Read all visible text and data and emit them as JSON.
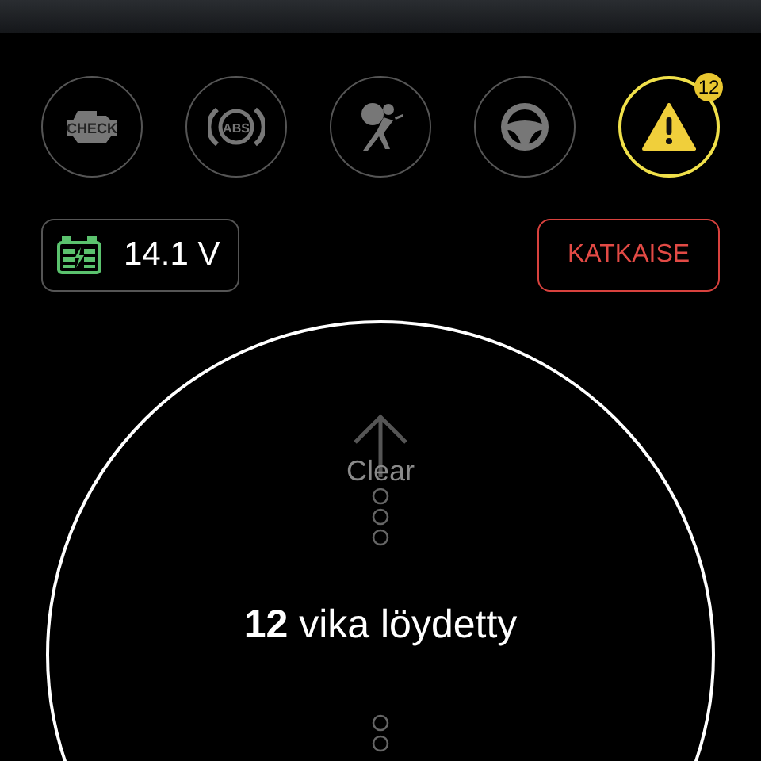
{
  "warning_lights": [
    {
      "kind": "engine",
      "label": "CHECK",
      "selected": false
    },
    {
      "kind": "abs",
      "label": "ABS",
      "selected": false
    },
    {
      "kind": "airbag",
      "selected": false
    },
    {
      "kind": "steering",
      "selected": false
    },
    {
      "kind": "warning",
      "selected": true,
      "badge": "12"
    }
  ],
  "battery": {
    "voltage": "14.1 V"
  },
  "disconnect_button": "KATKAISE",
  "dial": {
    "hint": "Clear",
    "count": "12",
    "message": "vika löydetty"
  }
}
